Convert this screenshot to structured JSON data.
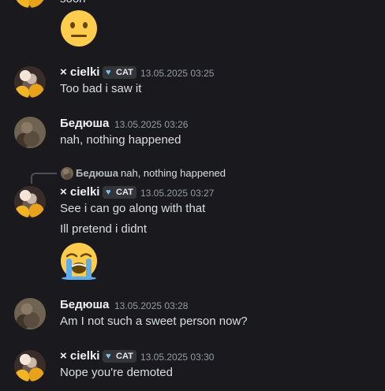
{
  "channel": {
    "messages": [
      {
        "author": "× cielki",
        "tag": "CAT",
        "timestamp": "13.05.2025 03:25",
        "lines": [
          "Too bad i saw it"
        ]
      },
      {
        "author": "Бедюша",
        "timestamp": "13.05.2025 03:26",
        "lines": [
          "nah, nothing happened"
        ]
      },
      {
        "reply": {
          "author": "Бедюша",
          "text": "nah, nothing happened"
        },
        "author": "× cielki",
        "tag": "CAT",
        "timestamp": "13.05.2025 03:27",
        "lines": [
          "See i can go along with that",
          "Ill pretend i didnt"
        ]
      },
      {
        "author": "Бедюша",
        "timestamp": "13.05.2025 03:28",
        "lines": [
          "Am I not such a sweet person now?"
        ]
      },
      {
        "author": "× cielki",
        "tag": "CAT",
        "timestamp": "13.05.2025 03:30",
        "lines": [
          "Nope you're demoted"
        ]
      }
    ],
    "top_partial_text": "soon",
    "emojis": {
      "neutral": "neutral-face-emoji",
      "crying": "loudly-crying-face-emoji"
    }
  },
  "colors": {
    "background": "#1a1a1e",
    "username": "#f2f3f5",
    "timestamp": "#949ba4",
    "message_text": "#dbdee1",
    "tag_background": "#34353b",
    "tag_heart": "#7cc6e9",
    "emoji_yellow": "#ffcc4d"
  }
}
